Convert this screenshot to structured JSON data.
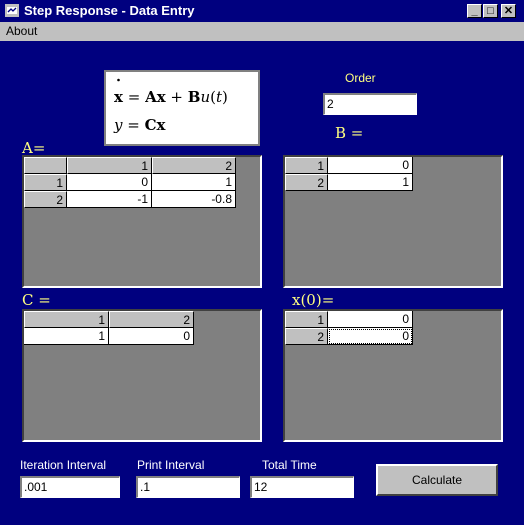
{
  "window": {
    "title": "Step Response - Data Entry"
  },
  "menu": {
    "items": [
      "About"
    ]
  },
  "equation": {
    "line1": "x = Ax + Bu(t)",
    "line2": "y = Cx"
  },
  "order": {
    "label": "Order",
    "value": "2"
  },
  "labels": {
    "A": "A=",
    "B": "B =",
    "C": "C =",
    "X0": "x(0)="
  },
  "gridA": {
    "col_headers": [
      "1",
      "2"
    ],
    "rows": [
      {
        "header": "1",
        "cells": [
          "0",
          "1"
        ]
      },
      {
        "header": "2",
        "cells": [
          "-1",
          "-0.8"
        ]
      }
    ]
  },
  "gridB": {
    "rows": [
      {
        "header": "1",
        "value": "0"
      },
      {
        "header": "2",
        "value": "1"
      }
    ]
  },
  "gridC": {
    "col_headers": [
      "1",
      "2"
    ],
    "values": [
      "1",
      "0"
    ]
  },
  "gridX0": {
    "rows": [
      {
        "header": "1",
        "value": "0"
      },
      {
        "header": "2",
        "value": "0"
      }
    ]
  },
  "fields": {
    "iteration": {
      "label": "Iteration Interval",
      "value": ".001"
    },
    "print": {
      "label": "Print Interval",
      "value": ".1"
    },
    "total": {
      "label": "Total Time",
      "value": "12"
    }
  },
  "buttons": {
    "calculate": "Calculate"
  },
  "colors": {
    "background": "#00007f",
    "label_yellow": "#ffff80",
    "panel_gray": "#808080",
    "button_face": "#c0c0c0"
  }
}
